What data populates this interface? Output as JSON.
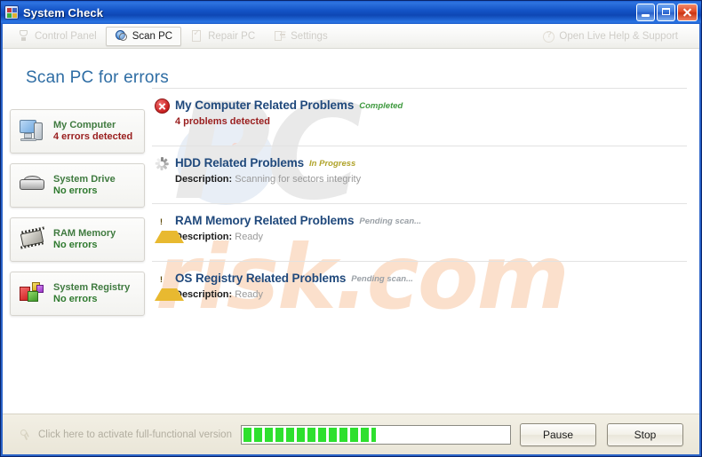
{
  "window": {
    "title": "System Check",
    "controls": {
      "minimize": "Minimize",
      "maximize": "Maximize",
      "close": "Close"
    }
  },
  "toolbar": {
    "items": [
      {
        "label": "Control Panel",
        "icon": "control-panel-icon",
        "active": false
      },
      {
        "label": "Scan PC",
        "icon": "scan-pc-icon",
        "active": true
      },
      {
        "label": "Repair PC",
        "icon": "repair-pc-icon",
        "active": false
      },
      {
        "label": "Settings",
        "icon": "settings-icon",
        "active": false
      }
    ],
    "help": {
      "label": "Open Live Help & Support",
      "icon": "help-icon"
    }
  },
  "page": {
    "heading": "Scan PC for errors"
  },
  "sidebar": {
    "items": [
      {
        "title": "My Computer",
        "status": "4 errors detected",
        "state": "error",
        "icon": "computer-icon"
      },
      {
        "title": "System Drive",
        "status": "No errors",
        "state": "ok",
        "icon": "hard-drive-icon"
      },
      {
        "title": "RAM Memory",
        "status": "No errors",
        "state": "ok",
        "icon": "ram-chip-icon"
      },
      {
        "title": "System Registry",
        "status": "No errors",
        "state": "ok",
        "icon": "registry-blocks-icon"
      }
    ]
  },
  "problems": [
    {
      "title": "My Computer Related Problems",
      "status": "Completed",
      "status_state": "completed",
      "icon": "error-circle-icon",
      "desc_label": "",
      "desc_value": "4 problems detected",
      "desc_error": true
    },
    {
      "title": "HDD Related Problems",
      "status": "In Progress",
      "status_state": "inprogress",
      "icon": "busy-spinner-icon",
      "desc_label": "Description:",
      "desc_value": "Scanning for sectors integrity",
      "desc_error": false
    },
    {
      "title": "RAM Memory Related Problems",
      "status": "Pending scan...",
      "status_state": "pending",
      "icon": "warning-triangle-icon",
      "desc_label": "Description:",
      "desc_value": "Ready",
      "desc_error": false
    },
    {
      "title": "OS Registry Related Problems",
      "status": "Pending scan...",
      "status_state": "pending",
      "icon": "warning-triangle-icon",
      "desc_label": "Description:",
      "desc_value": "Ready",
      "desc_error": false
    }
  ],
  "statusbar": {
    "activate_text": "Click here to activate full-functional version",
    "activate_icon": "key-icon",
    "progress_percent": 50,
    "pause_label": "Pause",
    "stop_label": "Stop"
  },
  "watermark": {
    "line1": "PC",
    "line2": "risk.com"
  },
  "colors": {
    "titlebar_blue": "#1453c6",
    "heading_blue": "#2e6da4",
    "problem_title_blue": "#20497c",
    "error_red": "#9a2020",
    "ok_green": "#2f7a2f",
    "status_completed": "#3f9a3f",
    "status_inprogress": "#b0a32a",
    "status_pending": "#9aa0a6",
    "progress_green": "#2ee02e",
    "statusbar_bg": "#eae6d8"
  }
}
